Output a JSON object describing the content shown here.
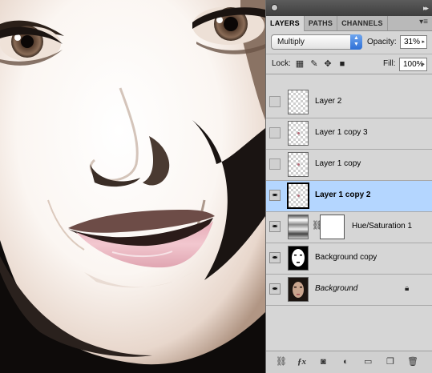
{
  "panel": {
    "tabs": [
      {
        "label": "LAYERS",
        "active": true
      },
      {
        "label": "PATHS",
        "active": false
      },
      {
        "label": "CHANNELS",
        "active": false
      }
    ],
    "blend_mode": "Multiply",
    "opacity_label": "Opacity:",
    "opacity_value": "31%",
    "lock_label": "Lock:",
    "fill_label": "Fill:",
    "fill_value": "100%",
    "layers": [
      {
        "name": "Layer 2",
        "visible": false,
        "selected": false,
        "thumbnail": "transparent"
      },
      {
        "name": "Layer 1 copy 3",
        "visible": false,
        "selected": false,
        "thumbnail": "transparent"
      },
      {
        "name": "Layer 1 copy",
        "visible": false,
        "selected": false,
        "thumbnail": "transparent"
      },
      {
        "name": "Layer 1 copy 2",
        "visible": true,
        "selected": true,
        "thumbnail": "transparent"
      },
      {
        "name": "Hue/Saturation 1",
        "visible": true,
        "selected": false,
        "thumbnail": "adjustment"
      },
      {
        "name": "Background copy",
        "visible": true,
        "selected": false,
        "thumbnail": "photo"
      },
      {
        "name": "Background",
        "visible": true,
        "selected": false,
        "thumbnail": "photo",
        "locked": true
      }
    ],
    "bottom_icons": [
      "link-icon",
      "fx-icon",
      "mask-icon",
      "adjustment-icon",
      "folder-icon",
      "new-layer-icon",
      "trash-icon"
    ]
  },
  "colors": {
    "selected_row": "#b4d6ff",
    "panel_bg": "#d6d6d6",
    "select_arrow_blue": "#2d6fd6"
  }
}
